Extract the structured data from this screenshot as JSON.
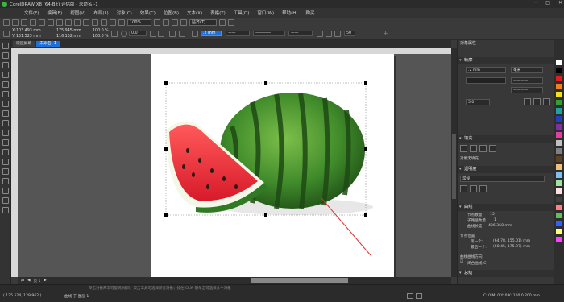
{
  "window": {
    "title": "CorelDRAW X8 (64-Bit) 评估版 - 未命名 -1",
    "controls": [
      "─",
      "□",
      "✕"
    ]
  },
  "menu": [
    "文件(F)",
    "编辑(E)",
    "视图(V)",
    "布局(L)",
    "对象(C)",
    "效果(C)",
    "位图(B)",
    "文本(X)",
    "表格(T)",
    "工具(O)",
    "窗口(W)",
    "帮助(H)",
    "购买"
  ],
  "toolbar": {
    "zoom": "100%",
    "snap": "贴齐(T)"
  },
  "property_bar": {
    "x": "103.493 mm",
    "y": "151.523 mm",
    "w": "175.945 mm",
    "h": "116.152 mm",
    "sx": "100.0",
    "sy": "100.0",
    "angle": "0.0",
    "outline_width": ".2 mm",
    "pct": "50"
  },
  "tabs": [
    "欢迎屏幕",
    "未命名 -1"
  ],
  "status": {
    "coords": "( 125.524, 129.962 )",
    "layer": "曲线 于 图层 1",
    "hint": "单击对象两次可旋转/倾斜；双击工具可选择所有对象；按住 Shift 键单击可选择多个对象",
    "fill_info": "C: 0 M: 0 Y: 0 K: 100  0.200 mm"
  },
  "page_tab": "页 1",
  "panel": {
    "title": "对象属性",
    "outline": {
      "label": "轮廓",
      "width": ".2 mm",
      "unit": "毫米",
      "miter": "5.0"
    },
    "fill": {
      "label": "填充",
      "value": "对象无填充"
    },
    "transparency": {
      "label": "透明度",
      "mode": "常规"
    },
    "curve": {
      "label": "曲线",
      "node_count_label": "节点数量",
      "node_count": "15",
      "subpath_label": "子路径数量",
      "subpath_count": "1",
      "length_label": "曲线长度",
      "length": "486.368 mm",
      "node_pos_label": "节点位置",
      "first_label": "第一个:",
      "first_val": "(64.78, 155.01) mm",
      "last_label": "最后一个:",
      "last_val": "(68.45, 175.97) mm",
      "direction_label": "曲线曲线方向",
      "closed_label": "闭合曲线(C)"
    },
    "summary": "总结"
  },
  "palette_colors": [
    "#ffffff",
    "#000000",
    "#e02020",
    "#f08020",
    "#f0e020",
    "#30a030",
    "#20a0a0",
    "#2040c0",
    "#8030a0",
    "#e040a0",
    "#c0c0c0",
    "#808080",
    "#604020",
    "#f0c080",
    "#80c0f0",
    "#a0e0a0",
    "#ffe0e0",
    "#404040",
    "#ff8080",
    "#60c060",
    "#3060ff",
    "#ffff80",
    "#ff40ff"
  ]
}
